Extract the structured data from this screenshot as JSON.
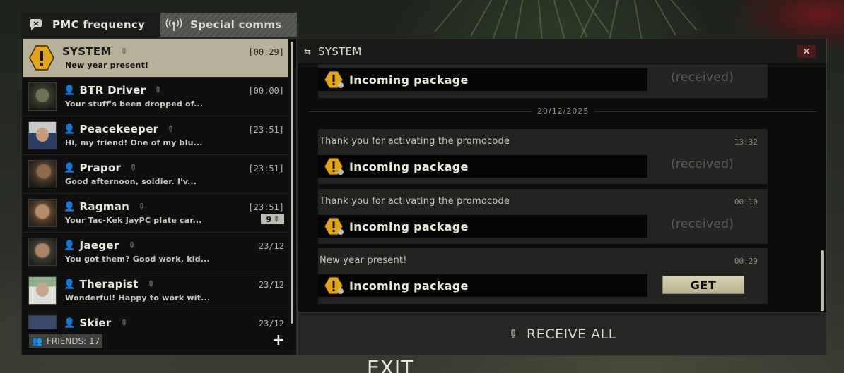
{
  "tabs": {
    "pmc": "PMC frequency",
    "special": "Special comms"
  },
  "chats": [
    {
      "name": "SYSTEM",
      "time": "[00:29]",
      "message": "New year present!",
      "active": true
    },
    {
      "name": "BTR Driver",
      "time": "[00:00]",
      "message": "Your stuff's been dropped of..."
    },
    {
      "name": "Peacekeeper",
      "time": "[23:51]",
      "message": "Hi, my friend! One of my blu..."
    },
    {
      "name": "Prapor",
      "time": "[23:51]",
      "message": "Good afternoon, soldier. I'v..."
    },
    {
      "name": "Ragman",
      "time": "[23:51]",
      "message": "Your Tac-Kek JayPC plate car...",
      "badge": "9"
    },
    {
      "name": "Jaeger",
      "time": "23/12",
      "message": "You got them? Good work, kid..."
    },
    {
      "name": "Therapist",
      "time": "23/12",
      "message": "Wonderful! Happy to work wit..."
    },
    {
      "name": "Skier",
      "time": "23/12",
      "message": ""
    }
  ],
  "footer": {
    "friends": "FRIENDS: 17",
    "add": "+"
  },
  "conversation": {
    "title": "SYSTEM",
    "close": "×",
    "date_divider": "20/12/2025",
    "package_label": "Incoming package",
    "received_label": "(received)",
    "get_label": "GET",
    "messages": [
      {
        "text": "Thank you for activating the promocode",
        "time": "13:32"
      },
      {
        "text": "Thank you for activating the promocode",
        "time": "00:10"
      },
      {
        "text": "New year present!",
        "time": "00:29"
      }
    ],
    "receive_all": "RECEIVE ALL"
  },
  "exit": "EXIT",
  "colors": {
    "accent_tan": "#b7b19a",
    "warning_yellow": "#e0a51c",
    "close_red": "#4b1a1a"
  }
}
